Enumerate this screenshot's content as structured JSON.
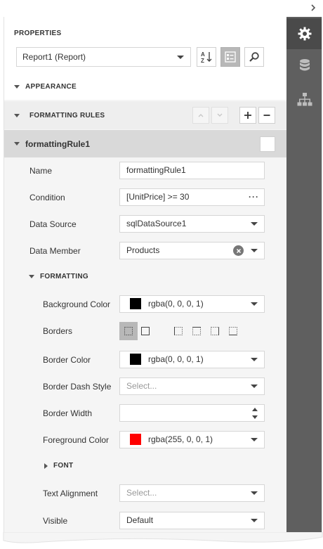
{
  "panel": {
    "title": "PROPERTIES",
    "object_selector": "Report1 (Report)"
  },
  "toolbar": {
    "sort_icon": "sort-alphabetical-icon",
    "categories_icon": "categorized-list-icon",
    "search_icon": "search-icon"
  },
  "sections": {
    "appearance": "APPEARANCE",
    "formatting_rules": "FORMATTING RULES"
  },
  "rule": {
    "name": "formattingRule1",
    "fields": {
      "name": {
        "label": "Name",
        "value": "formattingRule1"
      },
      "condition": {
        "label": "Condition",
        "value": "[UnitPrice] >= 30",
        "button": "···"
      },
      "data_source": {
        "label": "Data Source",
        "value": "sqlDataSource1"
      },
      "data_member": {
        "label": "Data Member",
        "value": "Products"
      }
    },
    "formatting": {
      "title": "FORMATTING",
      "background_color": {
        "label": "Background Color",
        "value": "rgba(0, 0, 0, 1)",
        "swatch": "#000000"
      },
      "borders": {
        "label": "Borders"
      },
      "border_color": {
        "label": "Border Color",
        "value": "rgba(0, 0, 0, 1)",
        "swatch": "#000000"
      },
      "border_dash_style": {
        "label": "Border Dash Style",
        "placeholder": "Select..."
      },
      "border_width": {
        "label": "Border Width",
        "value": ""
      },
      "foreground_color": {
        "label": "Foreground Color",
        "value": "rgba(255, 0, 0, 1)",
        "swatch": "#ff0000"
      },
      "font": {
        "title": "FONT"
      },
      "text_alignment": {
        "label": "Text Alignment",
        "placeholder": "Select..."
      },
      "visible": {
        "label": "Visible",
        "value": "Default"
      }
    }
  },
  "tabs": [
    "properties-tab",
    "field-list-tab",
    "report-explorer-tab"
  ],
  "colors": {
    "accent_active": "#b8b8b8",
    "tab_bar": "#5f5f5f",
    "rule_header": "#d9d9d9"
  }
}
